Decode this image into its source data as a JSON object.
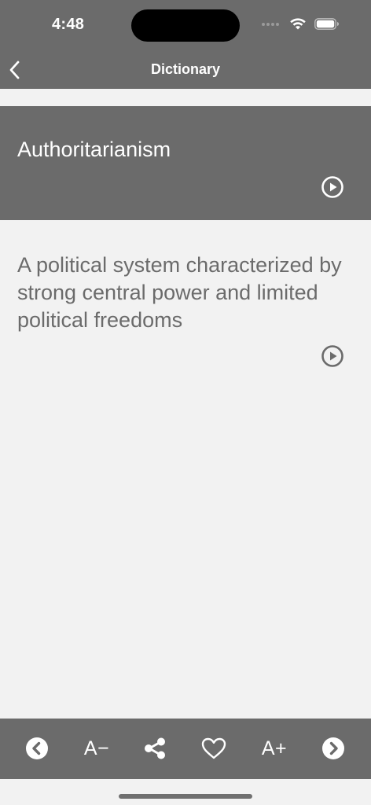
{
  "status_bar": {
    "time": "4:48"
  },
  "nav": {
    "title": "Dictionary",
    "back_icon": "chevron-left-icon"
  },
  "entry": {
    "word": "Authoritarianism",
    "definition": "A political system characterized by strong central power and limited political freedoms",
    "play_icon": "play-circle-icon"
  },
  "toolbar": {
    "font_smaller_label": "A−",
    "font_larger_label": "A+",
    "items": [
      "previous-icon",
      "font-smaller",
      "share-icon",
      "heart-icon",
      "font-larger",
      "next-icon"
    ]
  },
  "colors": {
    "bar_background": "#6b6b6b",
    "page_background": "#f2f2f2",
    "definition_text": "#6b6b6b",
    "bar_text": "#ffffff"
  }
}
